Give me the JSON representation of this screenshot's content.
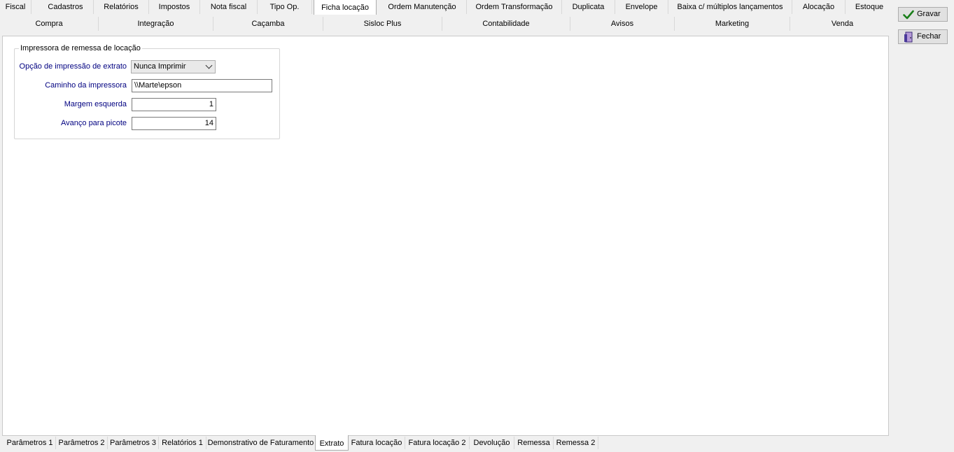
{
  "top_tabs_row1": [
    {
      "label": "Fiscal",
      "active": false
    },
    {
      "label": "Cadastros",
      "active": false
    },
    {
      "label": "Relatórios",
      "active": false
    },
    {
      "label": "Impostos",
      "active": false
    },
    {
      "label": "Nota fiscal",
      "active": false
    },
    {
      "label": "Tipo Op.",
      "active": false
    },
    {
      "label": "Ficha locação",
      "active": true
    },
    {
      "label": "Ordem Manutenção",
      "active": false
    },
    {
      "label": "Ordem Transformação",
      "active": false
    },
    {
      "label": "Duplicata",
      "active": false
    },
    {
      "label": "Envelope",
      "active": false
    },
    {
      "label": "Baixa c/ múltiplos lançamentos",
      "active": false
    },
    {
      "label": "Alocação",
      "active": false
    },
    {
      "label": "Estoque",
      "active": false
    }
  ],
  "top_tabs_row2": [
    {
      "label": "Compra"
    },
    {
      "label": "Integração"
    },
    {
      "label": "Caçamba"
    },
    {
      "label": "Sisloc Plus"
    },
    {
      "label": "Contabilidade"
    },
    {
      "label": "Avisos"
    },
    {
      "label": "Marketing"
    },
    {
      "label": "Venda"
    }
  ],
  "group": {
    "title": "Impressora de remessa de locação",
    "extract_option_label": "Opção de impressão de extrato",
    "extract_option_value": "Nunca Imprimir",
    "printer_path_label": "Caminho da impressora",
    "printer_path_value": "\\\\Marte\\epson",
    "left_margin_label": "Margem esquerda",
    "left_margin_value": "1",
    "picote_label": "Avanço para picote",
    "picote_value": "14"
  },
  "buttons": {
    "save_label": "Gravar",
    "close_label": "Fechar"
  },
  "bottom_tabs": [
    {
      "label": "Parâmetros 1",
      "active": false
    },
    {
      "label": "Parâmetros 2",
      "active": false
    },
    {
      "label": "Parâmetros 3",
      "active": false
    },
    {
      "label": "Relatórios 1",
      "active": false
    },
    {
      "label": "Demonstrativo de Faturamento",
      "active": false
    },
    {
      "label": "Extrato",
      "active": true
    },
    {
      "label": "Fatura locação",
      "active": false
    },
    {
      "label": "Fatura locação 2",
      "active": false
    },
    {
      "label": "Devolução",
      "active": false
    },
    {
      "label": "Remessa",
      "active": false
    },
    {
      "label": "Remessa 2",
      "active": false
    }
  ],
  "icons": {
    "save": "check-icon",
    "close": "exit-door-icon",
    "dropdown": "chevron-down-icon"
  },
  "colors": {
    "label_text": "#000080",
    "save_icon": "#1a7f1a",
    "panel_bg": "#ffffff",
    "window_bg": "#f0f0f0"
  }
}
